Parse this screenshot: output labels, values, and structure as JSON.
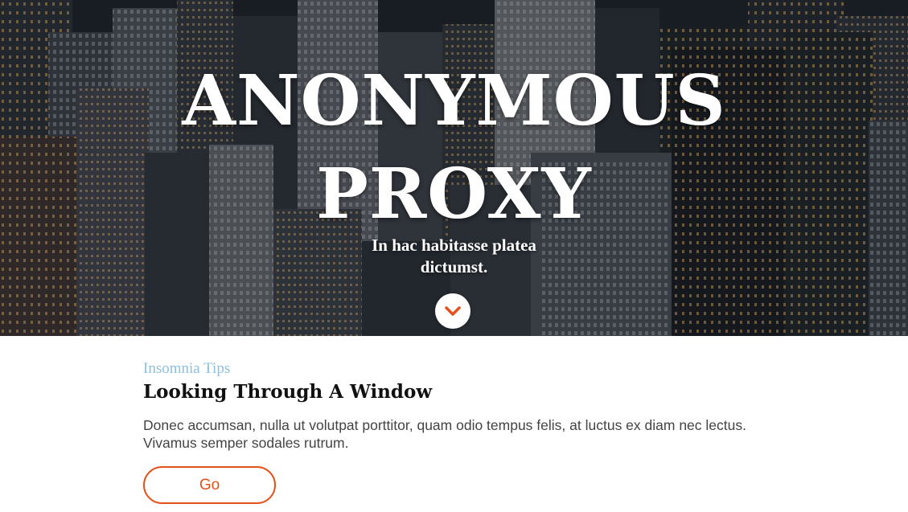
{
  "hero": {
    "title_line1": "ANONYMOUS",
    "title_line2": "PROXY",
    "subtitle_line1": "In hac habitasse platea",
    "subtitle_line2": "dictumst.",
    "scroll_icon": "chevron-down-icon",
    "accent_color": "#e4521b"
  },
  "post": {
    "category": "Insomnia Tips",
    "title": "Looking Through A Window",
    "body_line1": "Donec accumsan, nulla ut volutpat porttitor, quam odio tempus felis, at luctus ex diam nec lectus.",
    "body_line2": "Vivamus semper sodales rutrum.",
    "button_label": "Go",
    "category_color": "#8cc0de"
  }
}
